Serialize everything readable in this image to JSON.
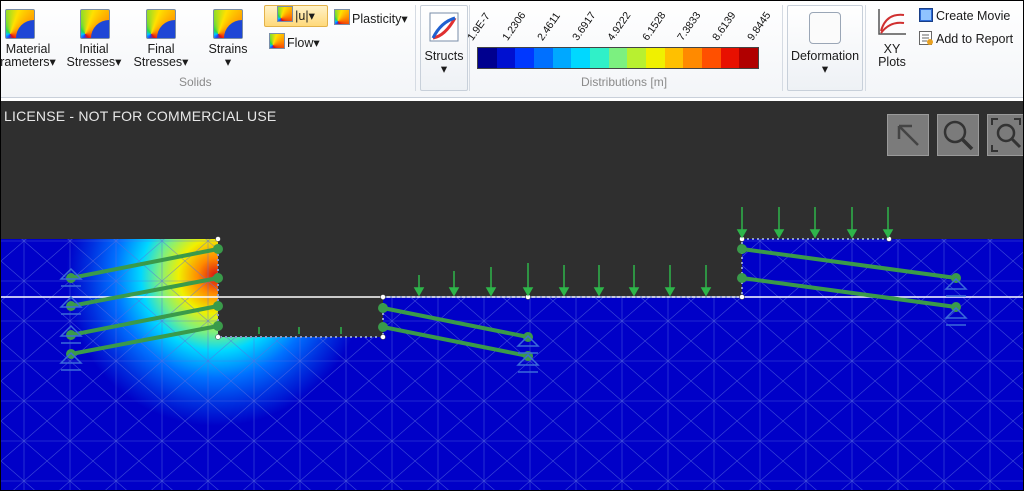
{
  "ribbon": {
    "solids": {
      "material_params": "Material\nParameters",
      "material_line1": "Material",
      "material_line2": "rameters",
      "initial_line1": "Initial",
      "initial_line2": "Stresses",
      "final_line1": "Final",
      "final_line2": "Stresses",
      "strains": "Strains",
      "u_label": "|u|",
      "flow_label": "Flow",
      "plasticity_label": "Plasticity",
      "group_label": "Solids"
    },
    "structs_label": "Structs",
    "distributions": {
      "group_label": "Distributions [m]",
      "ticks": [
        "1.9E-7",
        "1.2306",
        "2.4611",
        "3.6917",
        "4.9222",
        "6.1528",
        "7.3833",
        "8.6139",
        "9.8445"
      ],
      "colors": [
        "#00008f",
        "#0010d0",
        "#0038ff",
        "#0070ff",
        "#00a8ff",
        "#00d8ff",
        "#30f0c8",
        "#7cf080",
        "#b8f030",
        "#f0f000",
        "#ffc000",
        "#ff8a00",
        "#ff5000",
        "#e81000",
        "#b00000"
      ]
    },
    "deformation_label": "Deformation",
    "xy_plots_line1": "XY",
    "xy_plots_line2": "Plots",
    "create_movie": "Create Movie",
    "add_to_report": "Add to Report"
  },
  "canvas": {
    "license_text": "LICENSE - NOT FOR COMMERCIAL USE",
    "colors": {
      "background": "#2f2f2f",
      "soil_blue": "#0000c8",
      "anchor_green": "#3a9a4a",
      "load_green": "#2fb54a"
    }
  }
}
